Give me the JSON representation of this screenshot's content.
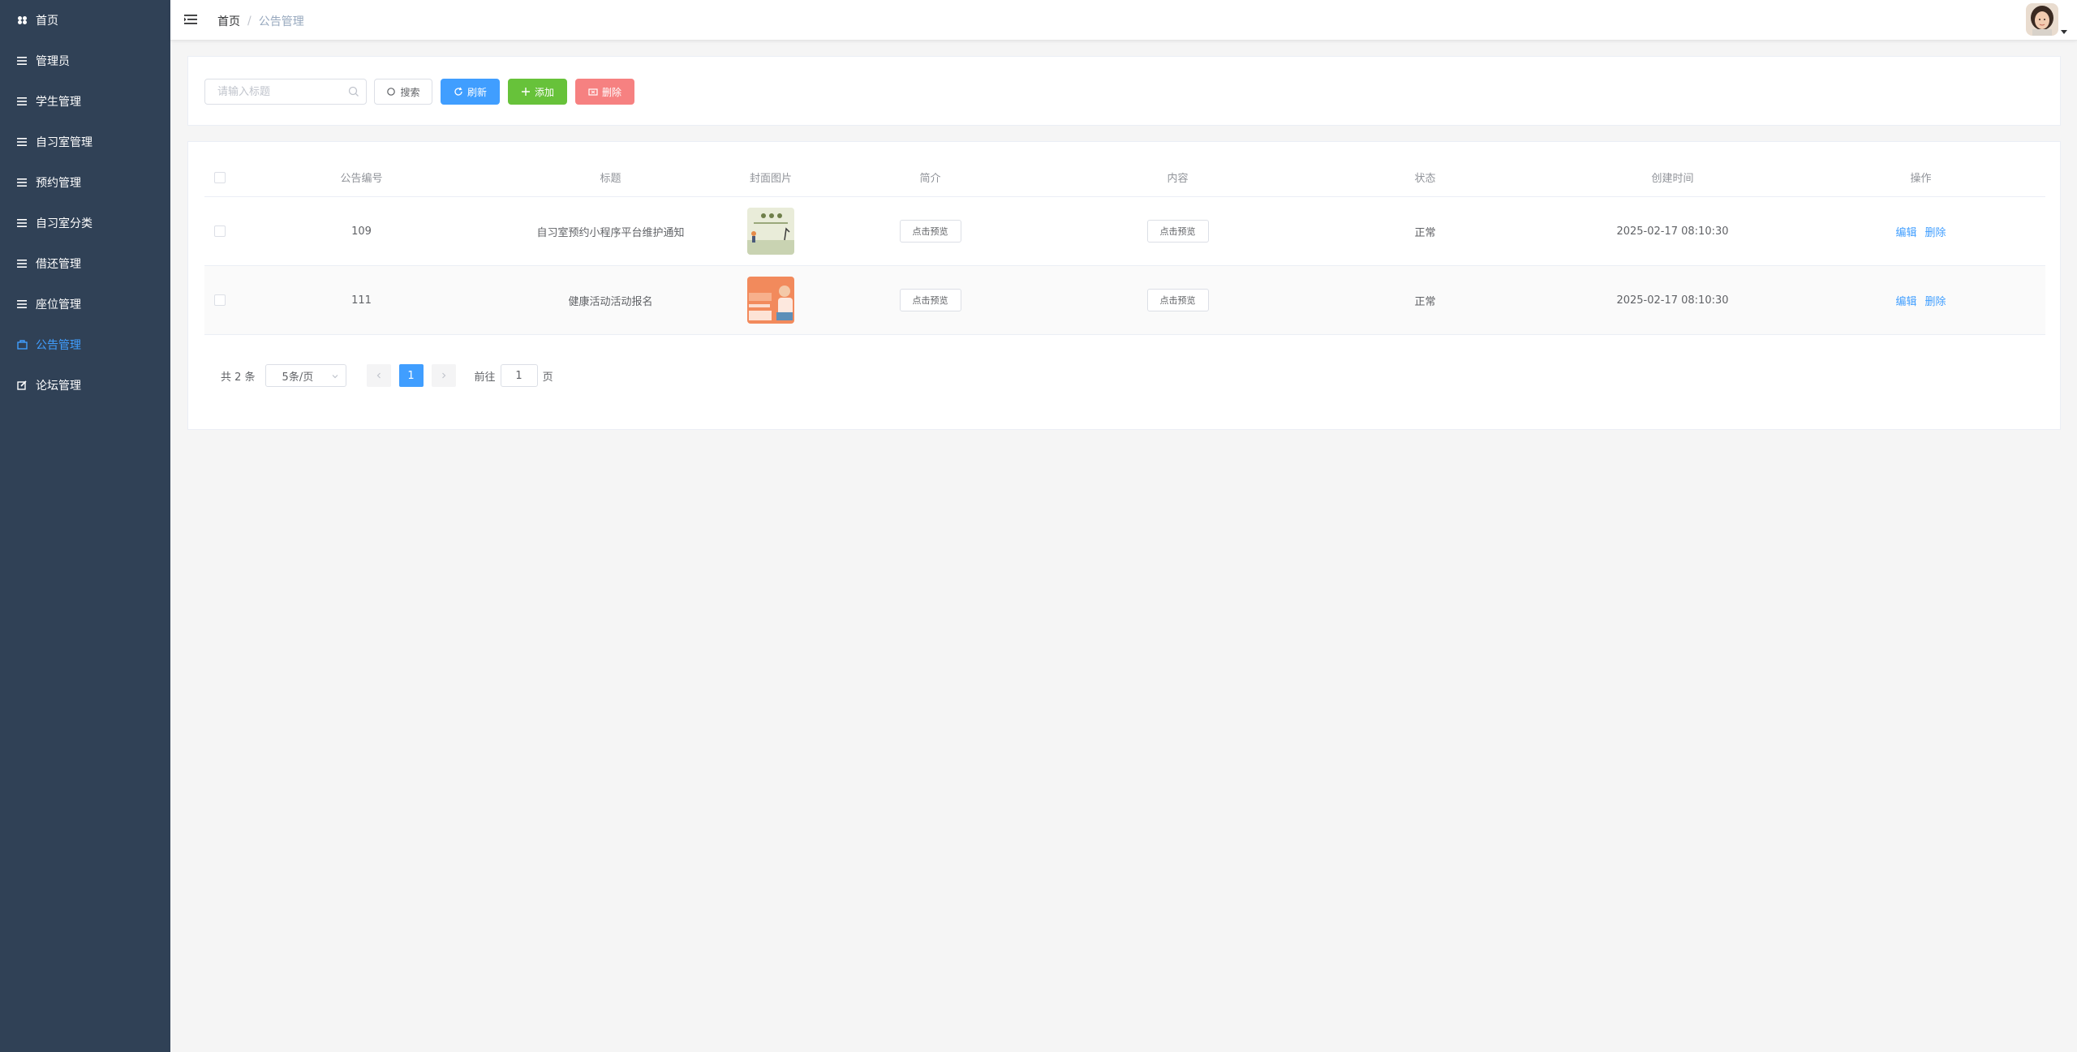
{
  "sidebar": {
    "items": [
      {
        "label": "首页",
        "icon": "dashboard-icon"
      },
      {
        "label": "管理员",
        "icon": "list-icon"
      },
      {
        "label": "学生管理",
        "icon": "list-icon"
      },
      {
        "label": "自习室管理",
        "icon": "list-icon"
      },
      {
        "label": "预约管理",
        "icon": "list-icon"
      },
      {
        "label": "自习室分类",
        "icon": "list-icon"
      },
      {
        "label": "借还管理",
        "icon": "list-icon"
      },
      {
        "label": "座位管理",
        "icon": "list-icon"
      },
      {
        "label": "公告管理",
        "icon": "notice-icon",
        "active": true
      },
      {
        "label": "论坛管理",
        "icon": "edit-icon"
      }
    ]
  },
  "header": {
    "breadcrumb_home": "首页",
    "breadcrumb_sep": "/",
    "breadcrumb_current": "公告管理"
  },
  "toolbar": {
    "search_placeholder": "请输入标题",
    "search_label": "搜索",
    "refresh_label": "刷新",
    "add_label": "添加",
    "delete_label": "删除"
  },
  "table": {
    "headers": [
      "公告编号",
      "标题",
      "封面图片",
      "简介",
      "内容",
      "状态",
      "创建时间",
      "操作"
    ],
    "rows": [
      {
        "id": "109",
        "title": "自习室预约小程序平台维护通知",
        "intro": "点击预览",
        "content": "点击预览",
        "status": "正常",
        "created": "2025-02-17 08:10:30",
        "edit": "编辑",
        "delete": "删除"
      },
      {
        "id": "111",
        "title": "健康活动活动报名",
        "intro": "点击预览",
        "content": "点击预览",
        "status": "正常",
        "created": "2025-02-17 08:10:30",
        "edit": "编辑",
        "delete": "删除"
      }
    ]
  },
  "pagination": {
    "total": "共 2 条",
    "page_size": "5条/页",
    "current_page": "1",
    "goto_prefix": "前往",
    "goto_value": "1",
    "goto_suffix": "页"
  },
  "colors": {
    "sidebar_bg": "#304156",
    "primary": "#409eff",
    "success": "#67c23a",
    "danger": "#f56c6c"
  }
}
